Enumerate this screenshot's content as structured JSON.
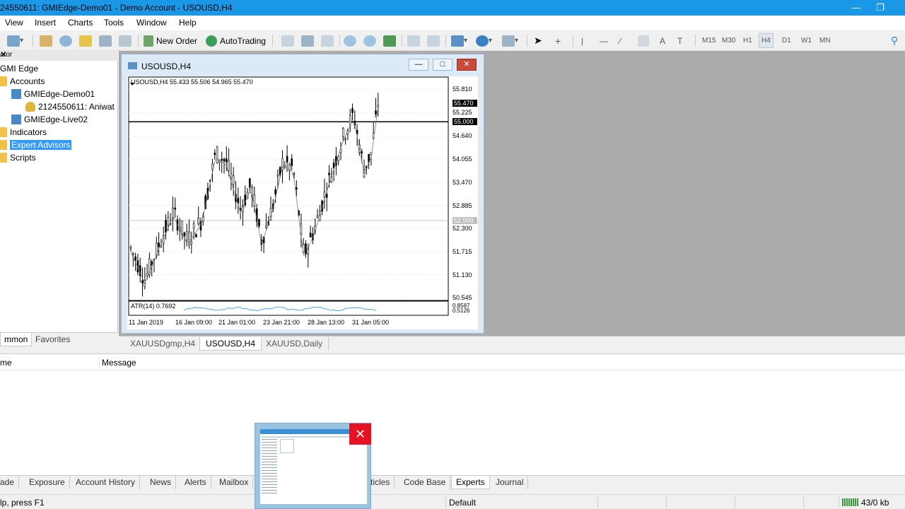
{
  "window": {
    "title": "24550611: GMIEdge-Demo01 - Demo Account - USOUSD,H4"
  },
  "menu": [
    "View",
    "Insert",
    "Charts",
    "Tools",
    "Window",
    "Help"
  ],
  "toolbar": {
    "new_order": "New Order",
    "auto_trading": "AutoTrading",
    "timeframes": [
      "M15",
      "M30",
      "H1",
      "H4",
      "D1",
      "W1",
      "MN"
    ],
    "active_timeframe": "H4"
  },
  "navigator": {
    "header": "ator",
    "root": "GMI Edge",
    "accounts": "Accounts",
    "demo_account": "GMIEdge-Demo01",
    "demo_login": "2124550611: Aniwat",
    "live_account": "GMIEdge-Live02",
    "indicators": "Indicators",
    "expert_advisors": "Expert Advisors",
    "scripts": "Scripts",
    "tab_common": "mmon",
    "tab_favorites": "Favorites"
  },
  "chart_window": {
    "title": "USOUSD,H4",
    "ohlc": "USOUSD,H4  55.433 55.506 54.965 55.470",
    "atr": "ATR(14) 0.7692",
    "price_ticks": [
      "55.810",
      "55.225",
      "54.640",
      "54.055",
      "53.470",
      "52.885",
      "52.300",
      "51.715",
      "51.130",
      "50.545"
    ],
    "current_price": "55.470",
    "level_1": "55.000",
    "level_2": "52.500",
    "atr_ticks": [
      "0.8587",
      "0.5126"
    ],
    "time_ticks": [
      "11 Jan 2019",
      "16 Jan 09:00",
      "21 Jan 01:00",
      "23 Jan 21:00",
      "28 Jan 13:00",
      "31 Jan 05:00"
    ]
  },
  "chart_tabs": [
    "XAUUSDgmp,H4",
    "USOUSD,H4",
    "XAUUSD,Daily"
  ],
  "active_chart_tab": "USOUSD,H4",
  "terminal": {
    "col_time": "me",
    "col_message": "Message",
    "tabs": [
      "ade",
      "Exposure",
      "Account History",
      "News",
      "Alerts",
      "Mailbox",
      "ticles",
      "Code Base",
      "Experts",
      "Journal"
    ],
    "active_tab": "Experts"
  },
  "status": {
    "help": "lp, press F1",
    "profile": "Default",
    "traffic": "43/0 kb"
  },
  "colors": {
    "accent": "#1a97e6",
    "selection": "#3399ff",
    "close": "#e81123"
  }
}
